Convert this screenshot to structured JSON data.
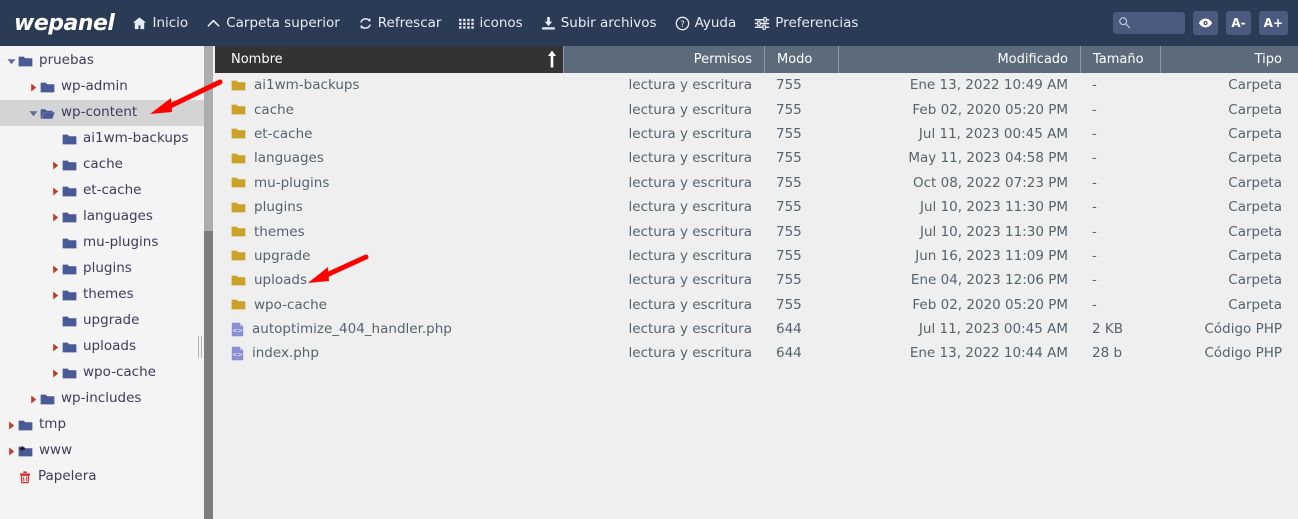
{
  "header": {
    "brand": "wepanel",
    "nav": [
      {
        "label": "Inicio",
        "icon": "home-icon"
      },
      {
        "label": "Carpeta superior",
        "icon": "chevron-up-icon"
      },
      {
        "label": "Refrescar",
        "icon": "refresh-icon"
      },
      {
        "label": "iconos",
        "icon": "grid-icon"
      },
      {
        "label": "Subir archivos",
        "icon": "upload-icon"
      },
      {
        "label": "Ayuda",
        "icon": "question-circle-icon"
      },
      {
        "label": "Preferencias",
        "icon": "sliders-icon"
      }
    ],
    "search": {
      "value": "",
      "placeholder": "",
      "icon": "search-icon"
    },
    "buttons": [
      {
        "label": "",
        "name": "eye-icon"
      },
      {
        "label": "A-",
        "name": "font-decrease-button"
      },
      {
        "label": "A+",
        "name": "font-increase-button"
      }
    ]
  },
  "sidebar": {
    "items": [
      {
        "label": "pruebas",
        "indent": 1,
        "twisty": "down",
        "icon": "folder-icon",
        "selected": false
      },
      {
        "label": "wp-admin",
        "indent": 2,
        "twisty": "right",
        "icon": "folder-icon",
        "selected": false
      },
      {
        "label": "wp-content",
        "indent": 2,
        "twisty": "down",
        "icon": "folder-open-icon",
        "selected": true
      },
      {
        "label": "ai1wm-backups",
        "indent": 3,
        "twisty": "none",
        "icon": "folder-icon",
        "selected": false
      },
      {
        "label": "cache",
        "indent": 3,
        "twisty": "right",
        "icon": "folder-icon",
        "selected": false
      },
      {
        "label": "et-cache",
        "indent": 3,
        "twisty": "right",
        "icon": "folder-icon",
        "selected": false
      },
      {
        "label": "languages",
        "indent": 3,
        "twisty": "right",
        "icon": "folder-icon",
        "selected": false
      },
      {
        "label": "mu-plugins",
        "indent": 3,
        "twisty": "none",
        "icon": "folder-icon",
        "selected": false
      },
      {
        "label": "plugins",
        "indent": 3,
        "twisty": "right",
        "icon": "folder-icon",
        "selected": false
      },
      {
        "label": "themes",
        "indent": 3,
        "twisty": "right",
        "icon": "folder-icon",
        "selected": false
      },
      {
        "label": "upgrade",
        "indent": 3,
        "twisty": "none",
        "icon": "folder-icon",
        "selected": false
      },
      {
        "label": "uploads",
        "indent": 3,
        "twisty": "right",
        "icon": "folder-icon",
        "selected": false
      },
      {
        "label": "wpo-cache",
        "indent": 3,
        "twisty": "right",
        "icon": "folder-icon",
        "selected": false
      },
      {
        "label": "wp-includes",
        "indent": 2,
        "twisty": "right",
        "icon": "folder-icon",
        "selected": false
      },
      {
        "label": "tmp",
        "indent": 1,
        "twisty": "right",
        "icon": "folder-icon",
        "selected": false
      },
      {
        "label": "www",
        "indent": 1,
        "twisty": "right",
        "icon": "folder-symlink-icon",
        "selected": false
      },
      {
        "label": "Papelera",
        "indent": 1,
        "twisty": "none",
        "icon": "trash-icon",
        "selected": false
      }
    ]
  },
  "table": {
    "columns": [
      {
        "key": "name",
        "label": "Nombre",
        "sorted": true,
        "sort_dir": "asc"
      },
      {
        "key": "perm",
        "label": "Permisos",
        "sorted": false,
        "sort_dir": ""
      },
      {
        "key": "mode",
        "label": "Modo",
        "sorted": false,
        "sort_dir": ""
      },
      {
        "key": "mod",
        "label": "Modificado",
        "sorted": false,
        "sort_dir": ""
      },
      {
        "key": "size",
        "label": "Tamaño",
        "sorted": false,
        "sort_dir": ""
      },
      {
        "key": "type",
        "label": "Tipo",
        "sorted": false,
        "sort_dir": ""
      }
    ],
    "rows": [
      {
        "name": "ai1wm-backups",
        "icon": "folder-icon",
        "perm": "lectura y escritura",
        "mode": "755",
        "mod": "Ene 13, 2022 10:49 AM",
        "size": "-",
        "type": "Carpeta"
      },
      {
        "name": "cache",
        "icon": "folder-icon",
        "perm": "lectura y escritura",
        "mode": "755",
        "mod": "Feb 02, 2020 05:20 PM",
        "size": "-",
        "type": "Carpeta"
      },
      {
        "name": "et-cache",
        "icon": "folder-icon",
        "perm": "lectura y escritura",
        "mode": "755",
        "mod": "Jul 11, 2023 00:45 AM",
        "size": "-",
        "type": "Carpeta"
      },
      {
        "name": "languages",
        "icon": "folder-icon",
        "perm": "lectura y escritura",
        "mode": "755",
        "mod": "May 11, 2023 04:58 PM",
        "size": "-",
        "type": "Carpeta"
      },
      {
        "name": "mu-plugins",
        "icon": "folder-icon",
        "perm": "lectura y escritura",
        "mode": "755",
        "mod": "Oct 08, 2022 07:23 PM",
        "size": "-",
        "type": "Carpeta"
      },
      {
        "name": "plugins",
        "icon": "folder-icon",
        "perm": "lectura y escritura",
        "mode": "755",
        "mod": "Jul 10, 2023 11:30 PM",
        "size": "-",
        "type": "Carpeta"
      },
      {
        "name": "themes",
        "icon": "folder-icon",
        "perm": "lectura y escritura",
        "mode": "755",
        "mod": "Jul 10, 2023 11:30 PM",
        "size": "-",
        "type": "Carpeta"
      },
      {
        "name": "upgrade",
        "icon": "folder-icon",
        "perm": "lectura y escritura",
        "mode": "755",
        "mod": "Jun 16, 2023 11:09 PM",
        "size": "-",
        "type": "Carpeta"
      },
      {
        "name": "uploads",
        "icon": "folder-icon",
        "perm": "lectura y escritura",
        "mode": "755",
        "mod": "Ene 04, 2023 12:06 PM",
        "size": "-",
        "type": "Carpeta"
      },
      {
        "name": "wpo-cache",
        "icon": "folder-icon",
        "perm": "lectura y escritura",
        "mode": "755",
        "mod": "Feb 02, 2020 05:20 PM",
        "size": "-",
        "type": "Carpeta"
      },
      {
        "name": "autoptimize_404_handler.php",
        "icon": "php-file-icon",
        "perm": "lectura y escritura",
        "mode": "644",
        "mod": "Jul 11, 2023 00:45 AM",
        "size": "2 KB",
        "type": "Código PHP"
      },
      {
        "name": "index.php",
        "icon": "php-file-icon",
        "perm": "lectura y escritura",
        "mode": "644",
        "mod": "Ene 13, 2022 10:44 AM",
        "size": "28 b",
        "type": "Código PHP"
      }
    ]
  },
  "annotations": [
    {
      "name": "arrow-pointing-wp-content",
      "target": "wp-content"
    },
    {
      "name": "arrow-pointing-uploads",
      "target": "uploads"
    }
  ],
  "colors": {
    "header_bg": "#2b3a55",
    "accent_folder": "#c9a227",
    "sidebar_folder": "#4a5a96",
    "annotation": "#ff0000",
    "header_active": "#333333",
    "header_inactive": "#5b6b7c"
  }
}
